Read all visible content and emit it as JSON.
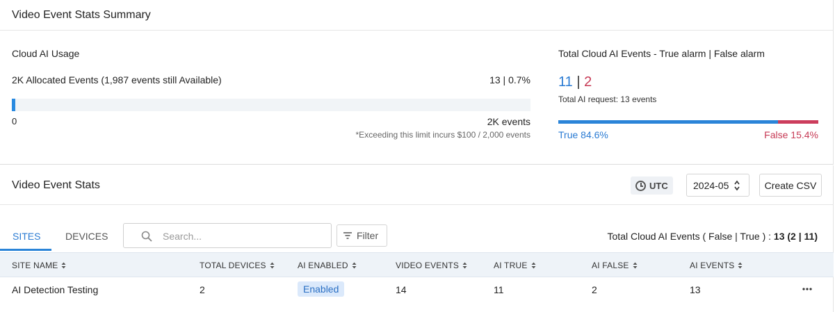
{
  "summary": {
    "title": "Video Event Stats Summary",
    "usage_label": "Cloud AI Usage",
    "allocated_text": "2K Allocated Events (1,987 events still Available)",
    "used_text": "13 | 0.7%",
    "used_fraction": 0.007,
    "axis_min": "0",
    "axis_max": "2K events",
    "note": "*Exceeding this limit incurs $100 / 2,000 events"
  },
  "totals": {
    "label": "Total Cloud AI Events - True alarm | False alarm",
    "true_count": "11",
    "separator": "|",
    "false_count": "2",
    "request_text": "Total AI request: 13 events",
    "true_fraction": 0.846,
    "false_fraction": 0.154,
    "true_label": "True 84.6%",
    "false_label": "False 15.4%",
    "true_color": "#2a84d8",
    "false_color": "#cc3d5c"
  },
  "stats": {
    "title": "Video Event Stats",
    "timezone": "UTC",
    "month": "2024-05",
    "csv_label": "Create CSV",
    "tabs": [
      {
        "label": "SITES",
        "active": true
      },
      {
        "label": "DEVICES",
        "active": false
      }
    ],
    "search_placeholder": "Search...",
    "filter_label": "Filter",
    "total_events_prefix": "Total Cloud AI Events ( False | True ) : ",
    "total_events_value": "13 (2 | 11)",
    "columns": [
      "SITE NAME",
      "TOTAL DEVICES",
      "AI ENABLED",
      "VIDEO EVENTS",
      "AI TRUE",
      "AI FALSE",
      "AI EVENTS"
    ],
    "rows": [
      {
        "site_name": "AI Detection Testing",
        "total_devices": "2",
        "ai_enabled": "Enabled",
        "video_events": "14",
        "ai_true": "11",
        "ai_false": "2",
        "ai_events": "13"
      }
    ]
  }
}
